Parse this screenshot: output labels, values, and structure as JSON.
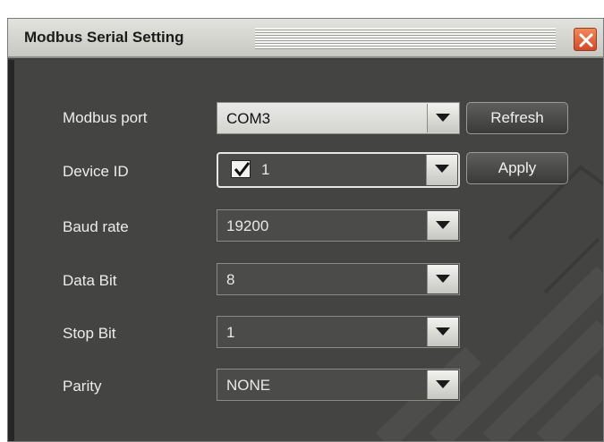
{
  "dialog": {
    "title": "Modbus Serial Setting"
  },
  "fields": [
    {
      "label": "Modbus port",
      "value": "COM3"
    },
    {
      "label": "Device ID",
      "value": "1",
      "checked": true
    },
    {
      "label": "Baud rate",
      "value": "19200"
    },
    {
      "label": "Data Bit",
      "value": "8"
    },
    {
      "label": "Stop Bit",
      "value": "1"
    },
    {
      "label": "Parity",
      "value": "NONE"
    }
  ],
  "buttons": {
    "refresh_label": "Refresh",
    "apply_label": "Apply"
  },
  "icons": {
    "close": "close-icon",
    "dropdown": "chevron-down-icon",
    "check": "checkmark-icon"
  },
  "colors": {
    "close_button": "#d2482a",
    "panel_background": "#444543",
    "text": "#ececec"
  }
}
